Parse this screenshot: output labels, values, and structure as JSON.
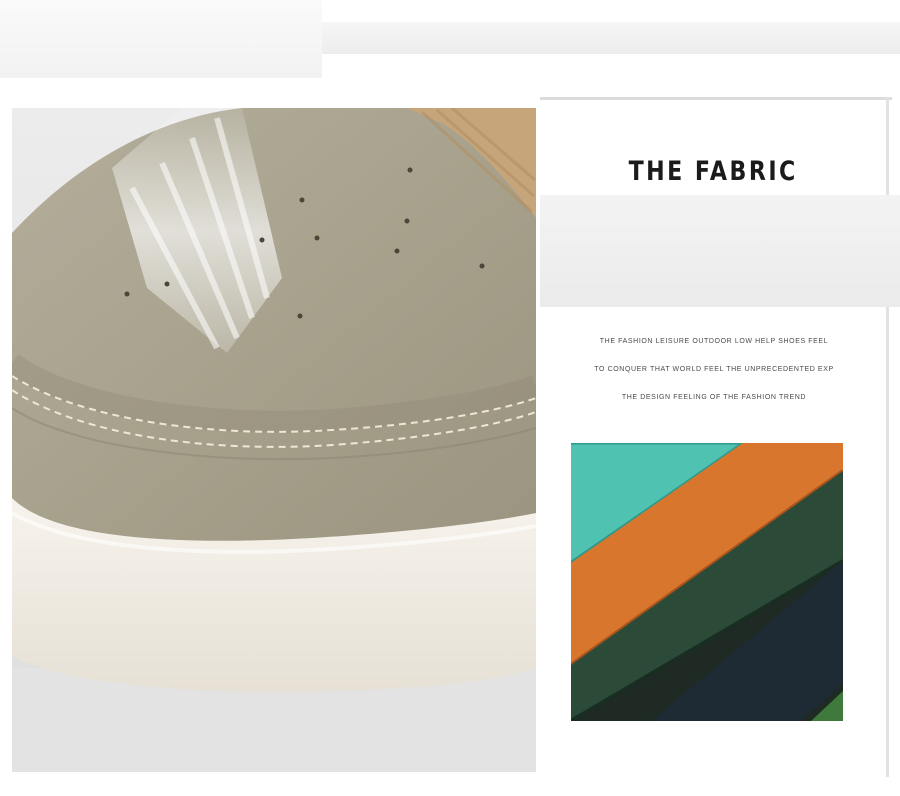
{
  "heading": "THE FABRIC",
  "description_lines": [
    "THE FASHION LEISURE OUTDOOR LOW HELP SHOES FEEL",
    "TO CONQUER THAT WORLD FEEL THE UNPRECEDENTED EXP",
    "THE DESIGN FEELING OF THE FASHION TREND"
  ],
  "colors": {
    "suede": "#a9a38f",
    "sole": "#f2ede4",
    "strap": "#c6a57a",
    "fabric_teal": "#4fc2b2",
    "fabric_orange": "#d9762e",
    "fabric_dark_green": "#2b4a38",
    "fabric_navy": "#1e2a34"
  }
}
